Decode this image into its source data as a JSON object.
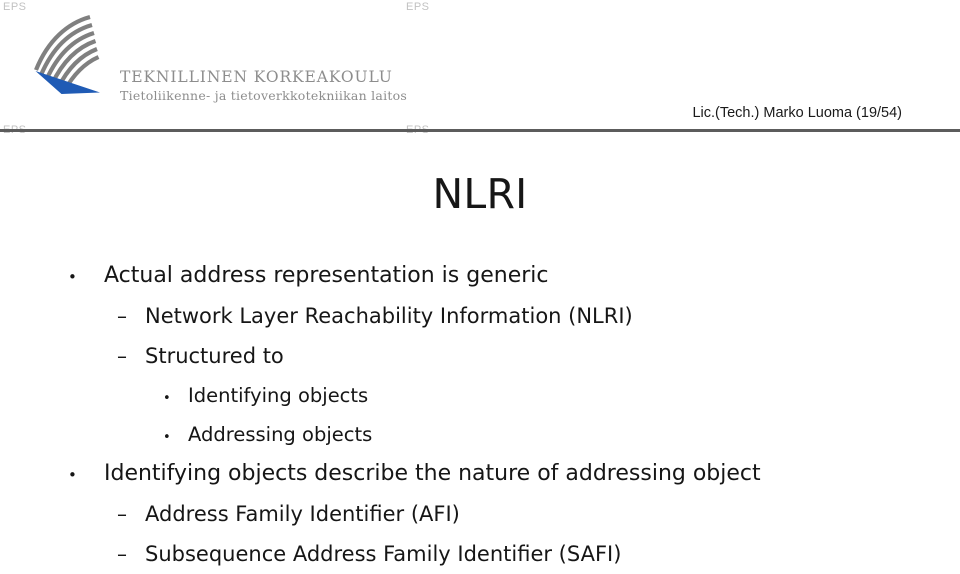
{
  "eps_marks": [
    {
      "label": "EPS",
      "position": "top-left"
    },
    {
      "label": "EPS",
      "position": "top-right"
    },
    {
      "label": "EPS",
      "position": "bottom-left"
    },
    {
      "label": "EPS",
      "position": "bottom-right"
    }
  ],
  "header": {
    "logo": {
      "icon": "tkk-wing-logo",
      "arc_color": "#808080",
      "accent_color": "#1f5bb5"
    },
    "organization": "TEKNILLINEN KORKEAKOULU",
    "department": "Tietoliikenne- ja tietoverkkotekniikan laitos",
    "presenter": "Lic.(Tech.) Marko Luoma (19/54)",
    "rule_color": "#5c5c5c",
    "wordmark_color": "#8d8d8d"
  },
  "slide": {
    "title": "NLRI",
    "text_color": "#161616",
    "bullets": [
      {
        "level": 1,
        "glyph": "•",
        "text": "Actual address representation is generic"
      },
      {
        "level": 2,
        "glyph": "–",
        "text": "Network Layer Reachability Information (NLRI)"
      },
      {
        "level": 2,
        "glyph": "–",
        "text": "Structured to"
      },
      {
        "level": 3,
        "glyph": "•",
        "text": "Identifying objects"
      },
      {
        "level": 3,
        "glyph": "•",
        "text": "Addressing objects"
      },
      {
        "level": 1,
        "glyph": "•",
        "text": "Identifying objects describe the nature of addressing object"
      },
      {
        "level": 2,
        "glyph": "–",
        "text": "Address Family Identifier (AFI)"
      },
      {
        "level": 2,
        "glyph": "–",
        "text": "Subsequence Address Family Identifier (SAFI)"
      }
    ]
  }
}
